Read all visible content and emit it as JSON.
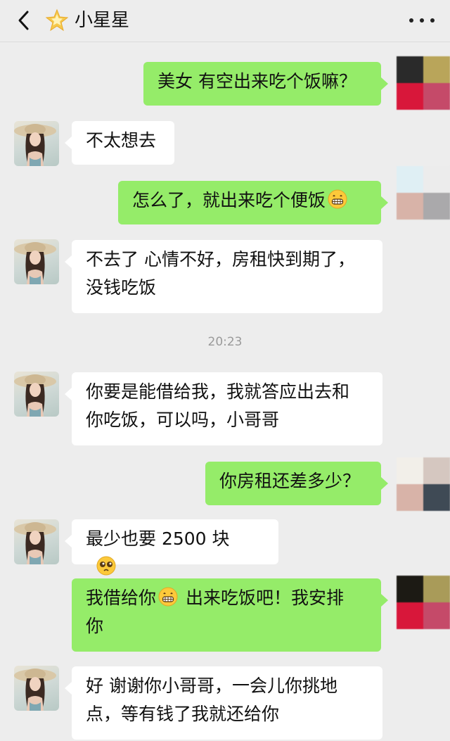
{
  "header": {
    "title": "小星星",
    "title_icon": "star-icon",
    "back_icon": "chevron-left-icon",
    "more_icon": "more-dots-icon"
  },
  "timestamp": "20:23",
  "messages": [
    {
      "side": "out",
      "text": "美女 有空出来吃个饭嘛？"
    },
    {
      "side": "in",
      "text": "不太想去"
    },
    {
      "side": "out",
      "text": "怎么了，就出来吃个便饭",
      "emoji": "grinning-face"
    },
    {
      "side": "in",
      "text": "不去了 心情不好，房租快到期了，\n没钱吃饭"
    },
    {
      "side": "in",
      "text": "你要是能借给我，我就答应出去和\n你吃饭，可以吗，小哥哥"
    },
    {
      "side": "out",
      "text": "你房租还差多少？"
    },
    {
      "side": "in",
      "text": "最少也要 2500 块",
      "emoji": "pleading-face"
    },
    {
      "side": "out",
      "text_before": "我借给你",
      "text_after": "出来吃饭吧！我安排\n你",
      "emoji": "grinning-face"
    },
    {
      "side": "in",
      "text": "好 谢谢你小哥哥，一会儿你挑地\n点，等有钱了我就还给你"
    }
  ],
  "colors": {
    "background": "#ededed",
    "outgoing_bubble": "#95ec69",
    "incoming_bubble": "#ffffff"
  }
}
